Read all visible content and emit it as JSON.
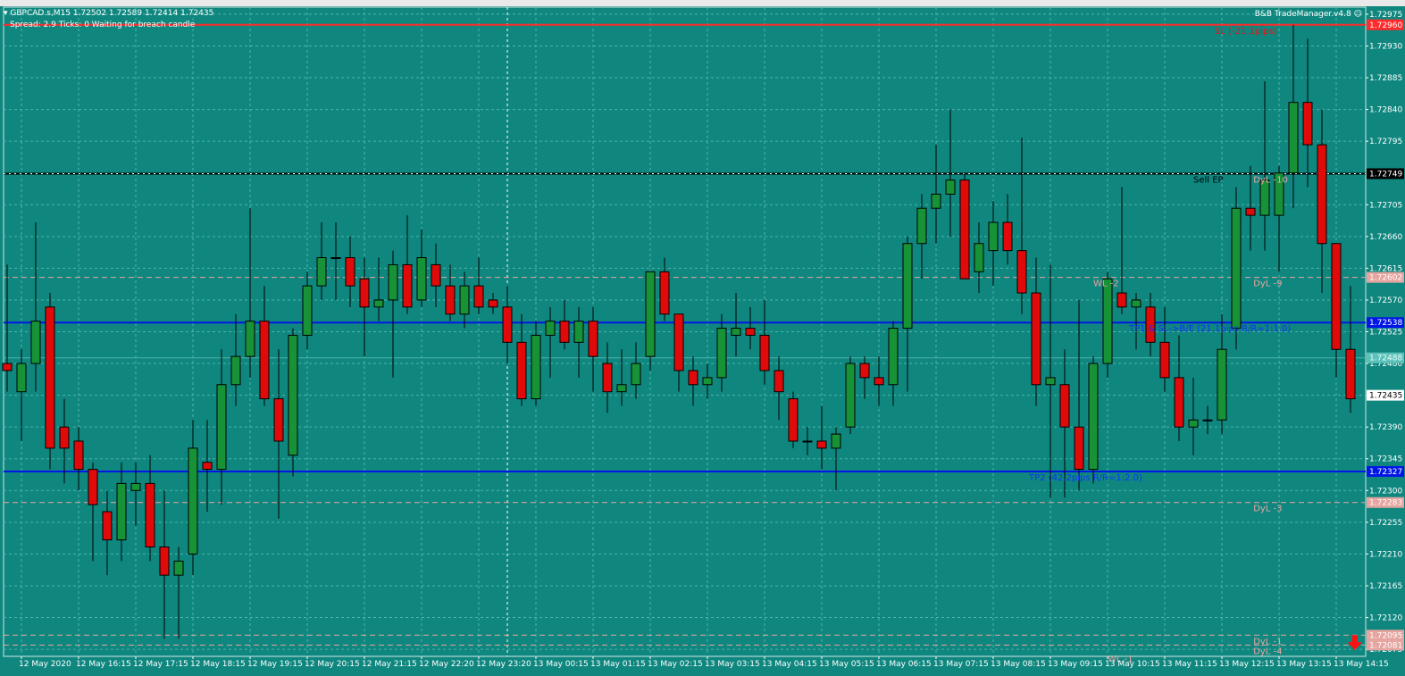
{
  "header": {
    "title": "GBPCAD.s,M15  1.72502 1.72589 1.72414 1.72435",
    "status": "Spread: 2.9   Ticks: 0   Waiting for breach candle",
    "brand": "B&B TradeManager.v4.8"
  },
  "colors": {
    "background": "#0f877f",
    "grid": "#4fb3ab",
    "bull": "#179237",
    "bear": "#e00a0a",
    "stop_line": "#ff2a2a",
    "tp_line": "#0016e6",
    "entry_line": "#000000",
    "dyl_line": "#e6a5a0"
  },
  "chart_data": {
    "type": "candlestick",
    "symbol": "GBPCAD.s",
    "timeframe": "M15",
    "ylim": [
      1.72065,
      1.72985
    ],
    "y_ticks": [
      "1.72975",
      "1.72930",
      "1.72885",
      "1.72840",
      "1.72795",
      "1.72705",
      "1.72660",
      "1.72615",
      "1.72570",
      "1.72525",
      "1.72480",
      "1.72435",
      "1.72390",
      "1.72345",
      "1.72300",
      "1.72255",
      "1.72210",
      "1.72165",
      "1.72120",
      "1.72075"
    ],
    "x_labels": [
      {
        "i": 1,
        "label": "12 May 2020"
      },
      {
        "i": 5,
        "label": "12 May 16:15"
      },
      {
        "i": 9,
        "label": "12 May 17:15"
      },
      {
        "i": 13,
        "label": "12 May 18:15"
      },
      {
        "i": 17,
        "label": "12 May 19:15"
      },
      {
        "i": 21,
        "label": "12 May 20:15"
      },
      {
        "i": 25,
        "label": "12 May 21:15"
      },
      {
        "i": 29,
        "label": "12 May 22:20"
      },
      {
        "i": 33,
        "label": "12 May 23:20"
      },
      {
        "i": 37,
        "label": "13 May 00:15"
      },
      {
        "i": 41,
        "label": "13 May 01:15"
      },
      {
        "i": 45,
        "label": "13 May 02:15"
      },
      {
        "i": 49,
        "label": "13 May 03:15"
      },
      {
        "i": 53,
        "label": "13 May 04:15"
      },
      {
        "i": 57,
        "label": "13 May 05:15"
      },
      {
        "i": 61,
        "label": "13 May 06:15"
      },
      {
        "i": 65,
        "label": "13 May 07:15"
      },
      {
        "i": 69,
        "label": "13 May 08:15"
      },
      {
        "i": 73,
        "label": "13 May 09:15"
      },
      {
        "i": 77,
        "label": "13 May 10:15"
      },
      {
        "i": 81,
        "label": "13 May 11:15"
      },
      {
        "i": 85,
        "label": "13 May 12:15"
      },
      {
        "i": 89,
        "label": "13 May 13:15"
      },
      {
        "i": 93,
        "label": "13 May 14:15"
      }
    ],
    "separator_index": 35,
    "candles": [
      {
        "o": 1.7248,
        "h": 1.7262,
        "l": 1.7244,
        "c": 1.7247
      },
      {
        "o": 1.7244,
        "h": 1.725,
        "l": 1.7237,
        "c": 1.7248
      },
      {
        "o": 1.7248,
        "h": 1.7268,
        "l": 1.7244,
        "c": 1.7254
      },
      {
        "o": 1.7256,
        "h": 1.7258,
        "l": 1.7233,
        "c": 1.7236
      },
      {
        "o": 1.7239,
        "h": 1.7243,
        "l": 1.7231,
        "c": 1.7236
      },
      {
        "o": 1.7237,
        "h": 1.7239,
        "l": 1.723,
        "c": 1.7233
      },
      {
        "o": 1.7233,
        "h": 1.7234,
        "l": 1.722,
        "c": 1.7228
      },
      {
        "o": 1.7227,
        "h": 1.723,
        "l": 1.7218,
        "c": 1.7223
      },
      {
        "o": 1.7223,
        "h": 1.7234,
        "l": 1.722,
        "c": 1.7231
      },
      {
        "o": 1.723,
        "h": 1.7234,
        "l": 1.7225,
        "c": 1.7231
      },
      {
        "o": 1.7231,
        "h": 1.7235,
        "l": 1.722,
        "c": 1.7222
      },
      {
        "o": 1.7222,
        "h": 1.723,
        "l": 1.7209,
        "c": 1.7218
      },
      {
        "o": 1.7218,
        "h": 1.7222,
        "l": 1.7209,
        "c": 1.722
      },
      {
        "o": 1.7221,
        "h": 1.724,
        "l": 1.7218,
        "c": 1.7236
      },
      {
        "o": 1.7234,
        "h": 1.724,
        "l": 1.7227,
        "c": 1.7233
      },
      {
        "o": 1.7233,
        "h": 1.725,
        "l": 1.7228,
        "c": 1.7245
      },
      {
        "o": 1.7245,
        "h": 1.7255,
        "l": 1.7242,
        "c": 1.7249
      },
      {
        "o": 1.7249,
        "h": 1.727,
        "l": 1.7246,
        "c": 1.7254
      },
      {
        "o": 1.7254,
        "h": 1.7259,
        "l": 1.7242,
        "c": 1.7243
      },
      {
        "o": 1.7243,
        "h": 1.725,
        "l": 1.7226,
        "c": 1.7237
      },
      {
        "o": 1.7235,
        "h": 1.7253,
        "l": 1.7232,
        "c": 1.7252
      },
      {
        "o": 1.7252,
        "h": 1.7261,
        "l": 1.725,
        "c": 1.7259
      },
      {
        "o": 1.7259,
        "h": 1.7268,
        "l": 1.7257,
        "c": 1.7263
      },
      {
        "o": 1.7263,
        "h": 1.7268,
        "l": 1.7257,
        "c": 1.7263
      },
      {
        "o": 1.7263,
        "h": 1.7266,
        "l": 1.7256,
        "c": 1.7259
      },
      {
        "o": 1.726,
        "h": 1.7263,
        "l": 1.7249,
        "c": 1.7256
      },
      {
        "o": 1.7256,
        "h": 1.7263,
        "l": 1.7254,
        "c": 1.7257
      },
      {
        "o": 1.7257,
        "h": 1.7264,
        "l": 1.7246,
        "c": 1.7262
      },
      {
        "o": 1.7262,
        "h": 1.7269,
        "l": 1.7255,
        "c": 1.7256
      },
      {
        "o": 1.7257,
        "h": 1.7267,
        "l": 1.7256,
        "c": 1.7263
      },
      {
        "o": 1.7262,
        "h": 1.7265,
        "l": 1.7256,
        "c": 1.7259
      },
      {
        "o": 1.7259,
        "h": 1.7262,
        "l": 1.7254,
        "c": 1.7255
      },
      {
        "o": 1.7255,
        "h": 1.7261,
        "l": 1.7253,
        "c": 1.7259
      },
      {
        "o": 1.7259,
        "h": 1.7263,
        "l": 1.7255,
        "c": 1.7256
      },
      {
        "o": 1.7257,
        "h": 1.7258,
        "l": 1.7255,
        "c": 1.7256
      },
      {
        "o": 1.7256,
        "h": 1.7259,
        "l": 1.7248,
        "c": 1.7251
      },
      {
        "o": 1.7251,
        "h": 1.7255,
        "l": 1.7242,
        "c": 1.7243
      },
      {
        "o": 1.7243,
        "h": 1.7254,
        "l": 1.7242,
        "c": 1.7252
      },
      {
        "o": 1.7252,
        "h": 1.7256,
        "l": 1.7246,
        "c": 1.7254
      },
      {
        "o": 1.7254,
        "h": 1.7257,
        "l": 1.725,
        "c": 1.7251
      },
      {
        "o": 1.7251,
        "h": 1.7256,
        "l": 1.7246,
        "c": 1.7254
      },
      {
        "o": 1.7254,
        "h": 1.7256,
        "l": 1.7244,
        "c": 1.7249
      },
      {
        "o": 1.7248,
        "h": 1.7251,
        "l": 1.7241,
        "c": 1.7244
      },
      {
        "o": 1.7244,
        "h": 1.725,
        "l": 1.7242,
        "c": 1.7245
      },
      {
        "o": 1.7245,
        "h": 1.7251,
        "l": 1.7243,
        "c": 1.7248
      },
      {
        "o": 1.7249,
        "h": 1.7261,
        "l": 1.7247,
        "c": 1.7261
      },
      {
        "o": 1.7261,
        "h": 1.7263,
        "l": 1.7254,
        "c": 1.7255
      },
      {
        "o": 1.7255,
        "h": 1.7255,
        "l": 1.7244,
        "c": 1.7247
      },
      {
        "o": 1.7247,
        "h": 1.7249,
        "l": 1.7242,
        "c": 1.7245
      },
      {
        "o": 1.7245,
        "h": 1.7248,
        "l": 1.7243,
        "c": 1.7246
      },
      {
        "o": 1.7246,
        "h": 1.7255,
        "l": 1.7244,
        "c": 1.7253
      },
      {
        "o": 1.7252,
        "h": 1.7258,
        "l": 1.7249,
        "c": 1.7253
      },
      {
        "o": 1.7253,
        "h": 1.7256,
        "l": 1.725,
        "c": 1.7252
      },
      {
        "o": 1.7252,
        "h": 1.7257,
        "l": 1.7245,
        "c": 1.7247
      },
      {
        "o": 1.7247,
        "h": 1.7249,
        "l": 1.724,
        "c": 1.7244
      },
      {
        "o": 1.7243,
        "h": 1.7244,
        "l": 1.7236,
        "c": 1.7237
      },
      {
        "o": 1.7237,
        "h": 1.7239,
        "l": 1.7235,
        "c": 1.7237
      },
      {
        "o": 1.7237,
        "h": 1.7242,
        "l": 1.7233,
        "c": 1.7236
      },
      {
        "o": 1.7236,
        "h": 1.7239,
        "l": 1.723,
        "c": 1.7238
      },
      {
        "o": 1.7239,
        "h": 1.7249,
        "l": 1.7238,
        "c": 1.7248
      },
      {
        "o": 1.7248,
        "h": 1.7249,
        "l": 1.7243,
        "c": 1.7246
      },
      {
        "o": 1.7246,
        "h": 1.7249,
        "l": 1.7242,
        "c": 1.7245
      },
      {
        "o": 1.7245,
        "h": 1.7254,
        "l": 1.7242,
        "c": 1.7253
      },
      {
        "o": 1.7253,
        "h": 1.7266,
        "l": 1.7244,
        "c": 1.7265
      },
      {
        "o": 1.7265,
        "h": 1.7272,
        "l": 1.726,
        "c": 1.727
      },
      {
        "o": 1.727,
        "h": 1.7279,
        "l": 1.7265,
        "c": 1.7272
      },
      {
        "o": 1.7272,
        "h": 1.7284,
        "l": 1.7266,
        "c": 1.7274
      },
      {
        "o": 1.7274,
        "h": 1.7275,
        "l": 1.726,
        "c": 1.726
      },
      {
        "o": 1.7261,
        "h": 1.7268,
        "l": 1.7258,
        "c": 1.7265
      },
      {
        "o": 1.7264,
        "h": 1.7271,
        "l": 1.7259,
        "c": 1.7268
      },
      {
        "o": 1.7268,
        "h": 1.7272,
        "l": 1.7262,
        "c": 1.7264
      },
      {
        "o": 1.7264,
        "h": 1.728,
        "l": 1.7255,
        "c": 1.7258
      },
      {
        "o": 1.7258,
        "h": 1.7263,
        "l": 1.7242,
        "c": 1.7245
      },
      {
        "o": 1.7245,
        "h": 1.7262,
        "l": 1.7229,
        "c": 1.7246
      },
      {
        "o": 1.7245,
        "h": 1.725,
        "l": 1.7229,
        "c": 1.7239
      },
      {
        "o": 1.7239,
        "h": 1.7257,
        "l": 1.723,
        "c": 1.7233
      },
      {
        "o": 1.7233,
        "h": 1.7249,
        "l": 1.7231,
        "c": 1.7248
      },
      {
        "o": 1.7248,
        "h": 1.7261,
        "l": 1.7246,
        "c": 1.726
      },
      {
        "o": 1.7258,
        "h": 1.7273,
        "l": 1.7255,
        "c": 1.7256
      },
      {
        "o": 1.7256,
        "h": 1.7258,
        "l": 1.725,
        "c": 1.7257
      },
      {
        "o": 1.7256,
        "h": 1.7258,
        "l": 1.7249,
        "c": 1.7251
      },
      {
        "o": 1.7251,
        "h": 1.7256,
        "l": 1.7244,
        "c": 1.7246
      },
      {
        "o": 1.7246,
        "h": 1.7252,
        "l": 1.7237,
        "c": 1.7239
      },
      {
        "o": 1.7239,
        "h": 1.7246,
        "l": 1.7235,
        "c": 1.724
      },
      {
        "o": 1.724,
        "h": 1.7242,
        "l": 1.7238,
        "c": 1.724
      },
      {
        "o": 1.724,
        "h": 1.7255,
        "l": 1.7238,
        "c": 1.725
      },
      {
        "o": 1.7253,
        "h": 1.7273,
        "l": 1.725,
        "c": 1.727
      },
      {
        "o": 1.727,
        "h": 1.7276,
        "l": 1.7264,
        "c": 1.7269
      },
      {
        "o": 1.7269,
        "h": 1.7288,
        "l": 1.7264,
        "c": 1.7274
      },
      {
        "o": 1.7269,
        "h": 1.7276,
        "l": 1.7261,
        "c": 1.7275
      },
      {
        "o": 1.7275,
        "h": 1.7296,
        "l": 1.727,
        "c": 1.7285
      },
      {
        "o": 1.7285,
        "h": 1.7294,
        "l": 1.7273,
        "c": 1.7279
      },
      {
        "o": 1.7279,
        "h": 1.7284,
        "l": 1.7258,
        "c": 1.7265
      },
      {
        "o": 1.7265,
        "h": 1.7263,
        "l": 1.7246,
        "c": 1.725
      },
      {
        "o": 1.725,
        "h": 1.7259,
        "l": 1.7241,
        "c": 1.7243
      }
    ],
    "levels": [
      {
        "key": "sl",
        "price": 1.7296,
        "tag": "1.72960",
        "color": "#ff2a2a",
        "style": "solid",
        "label": "SL (-21.1pips)",
        "label_index": 84.5,
        "label_color": "#e01818",
        "label_above": false
      },
      {
        "key": "sell",
        "price": 1.72749,
        "tag": "1.72749",
        "color": "#000000",
        "style": "solid",
        "label": "Sell EP",
        "label_index": 83,
        "label_color": "#000000",
        "label_above": false
      },
      {
        "key": "dyl10",
        "price": 1.72749,
        "tag": "",
        "color": "",
        "style": "none",
        "label": "DyL -10",
        "label_index": 87.2,
        "label_color": "#e6a5a0",
        "label_above": false
      },
      {
        "key": "dyl9",
        "price": 1.72602,
        "tag": "1.72602",
        "color": "#e6a5a0",
        "style": "dash",
        "label": "DyL -9",
        "label_index": 87.2,
        "label_color": "#e6a5a0",
        "label_above": false
      },
      {
        "key": "wl2",
        "price": 1.72602,
        "tag": "",
        "color": "",
        "style": "none",
        "label": "WL -2",
        "label_index": 76,
        "label_color": "#e6a5a0",
        "label_above": false
      },
      {
        "key": "tp1",
        "price": 1.72538,
        "tag": "1.72538",
        "color": "#0016e6",
        "style": "solid",
        "label": "TP1 & SL->B/E (21.1pips R/R=1:1.0)",
        "label_index": 78.5,
        "label_color": "#1030ff",
        "label_above": false
      },
      {
        "key": "cur",
        "price": 1.72488,
        "tag": "1.72488",
        "color": "#4fb3ab",
        "style": "solid",
        "label": "",
        "label_index": 0,
        "label_color": "",
        "label_above": false
      },
      {
        "key": "bid",
        "price": 1.72435,
        "tag": "1.72435",
        "color": "",
        "style": "none",
        "label": "",
        "label_index": 0,
        "label_color": "",
        "label_above": false
      },
      {
        "key": "tp2",
        "price": 1.72327,
        "tag": "1.72327",
        "color": "#0016e6",
        "style": "solid",
        "label": "TP2 (42.2pips R/R=1:2.0)",
        "label_index": 71.5,
        "label_color": "#1030ff",
        "label_above": false
      },
      {
        "key": "dyl3",
        "price": 1.72283,
        "tag": "1.72283",
        "color": "#e6a5a0",
        "style": "dash",
        "label": "DyL -3",
        "label_index": 87.2,
        "label_color": "#e6a5a0",
        "label_above": false
      },
      {
        "key": "dyl1",
        "price": 1.72095,
        "tag": "1.72095",
        "color": "#e6a5a0",
        "style": "dash",
        "label": "DyL -1",
        "label_index": 87.2,
        "label_color": "#e6a5a0",
        "label_above": false
      },
      {
        "key": "dyl4",
        "price": 1.72081,
        "tag": "1.72081",
        "color": "#e6a5a0",
        "style": "dash",
        "label": "DyL -4",
        "label_index": 87.2,
        "label_color": "#e6a5a0",
        "label_above": false
      },
      {
        "key": "wl1",
        "price": 1.7207,
        "tag": "",
        "color": "",
        "style": "none",
        "label": "WL -1",
        "label_index": 77,
        "label_color": "#e6a5a0",
        "label_above": false
      }
    ],
    "signal": {
      "type": "sell-arrow",
      "index": 94.3,
      "price": 1.7208
    }
  }
}
